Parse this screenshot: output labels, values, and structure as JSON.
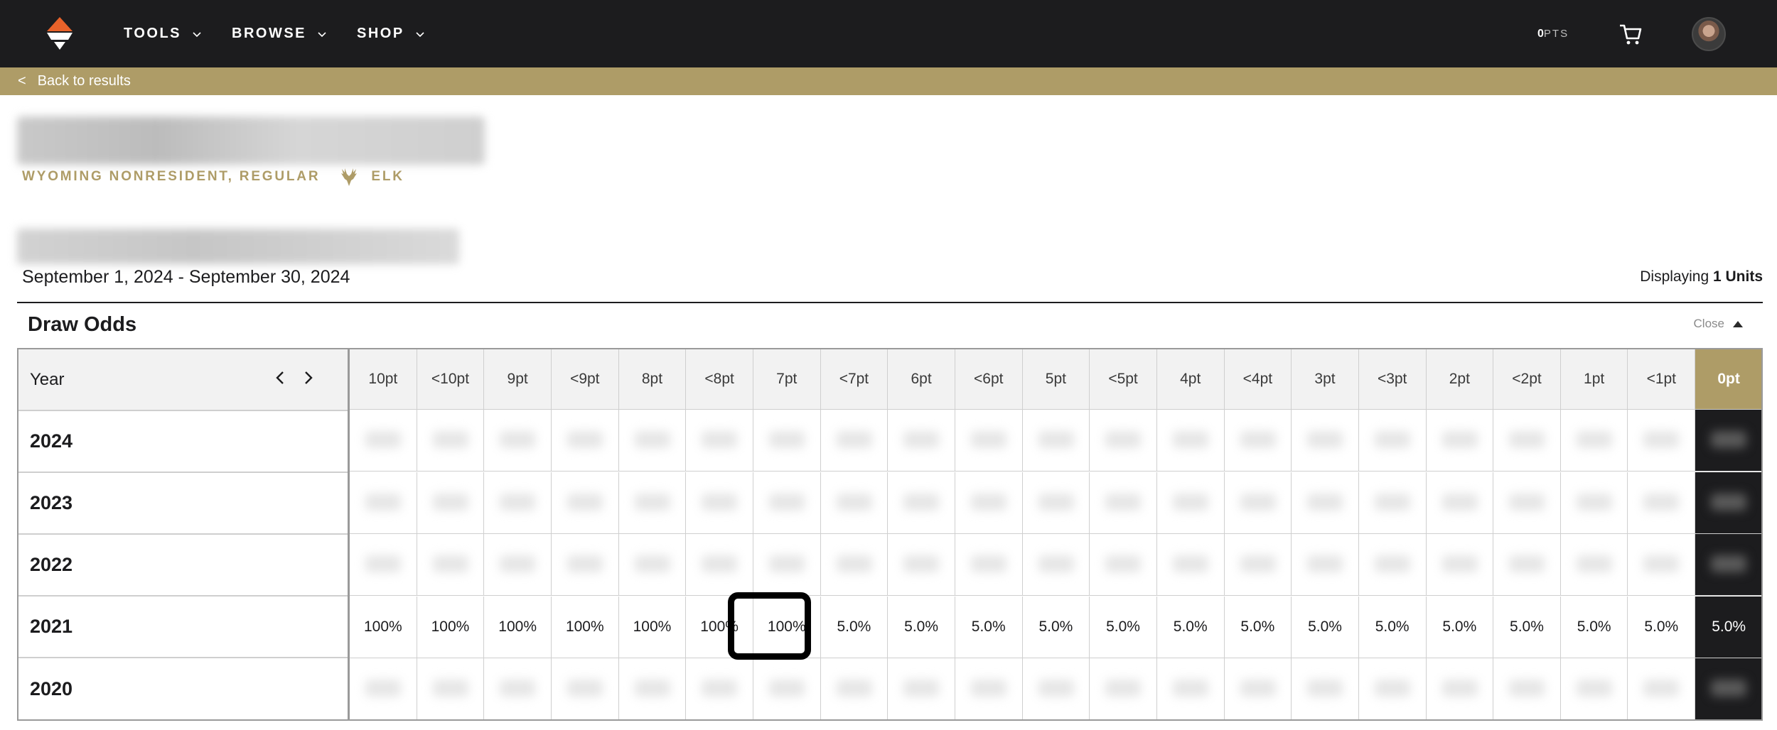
{
  "nav": {
    "items": [
      {
        "label": "TOOLS",
        "icon": "chevron-down-icon"
      },
      {
        "label": "BROWSE",
        "icon": "chevron-down-icon"
      },
      {
        "label": "SHOP",
        "icon": "chevron-down-icon"
      }
    ],
    "points_value": "0",
    "points_suffix": "PTS",
    "cart_icon": "cart-icon",
    "brand_color": "#ae9c67",
    "accent_color": "#e8622a"
  },
  "backbar": {
    "chevron": "<",
    "label": "Back to results"
  },
  "header": {
    "subtitle_state": "WYOMING NONRESIDENT, REGULAR",
    "subtitle_species": "ELK",
    "date_range": "September 1, 2024 - September 30, 2024",
    "displaying_prefix": "Displaying",
    "displaying_count": "1 Units"
  },
  "draw_odds": {
    "title": "Draw Odds",
    "close_label": "Close",
    "year_header": "Year",
    "point_columns": [
      "10pt",
      "<10pt",
      "9pt",
      "<9pt",
      "8pt",
      "<8pt",
      "7pt",
      "<7pt",
      "6pt",
      "<6pt",
      "5pt",
      "<5pt",
      "4pt",
      "<4pt",
      "3pt",
      "<3pt",
      "2pt",
      "<2pt",
      "1pt",
      "<1pt",
      "0pt"
    ],
    "rows": [
      {
        "year": "2024",
        "values": []
      },
      {
        "year": "2023",
        "values": []
      },
      {
        "year": "2022",
        "values": []
      },
      {
        "year": "2021",
        "values": [
          "100%",
          "100%",
          "100%",
          "100%",
          "100%",
          "100%",
          "100%",
          "5.0%",
          "5.0%",
          "5.0%",
          "5.0%",
          "5.0%",
          "5.0%",
          "5.0%",
          "5.0%",
          "5.0%",
          "5.0%",
          "5.0%",
          "5.0%",
          "5.0%",
          "5.0%"
        ]
      },
      {
        "year": "2020",
        "values": []
      }
    ]
  }
}
